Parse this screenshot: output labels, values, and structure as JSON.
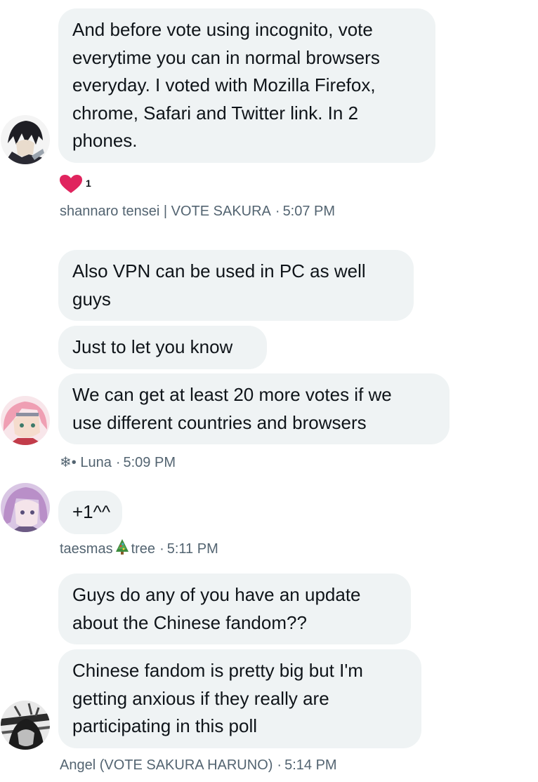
{
  "messages": [
    {
      "text": "And before vote using incognito, vote\neverytime you can in normal browsers\neveryday. I voted with Mozilla Firefox,\nchrome, Safari and Twitter link. In 2\nphones."
    },
    {
      "text": "Also VPN can be used in PC as well\nguys"
    },
    {
      "text": "Just to let you know"
    },
    {
      "text": "We can get at least 20 more votes if we\nuse different countries and browsers"
    },
    {
      "text": "+1^^"
    },
    {
      "text": "Guys do any of you have an update\nabout the Chinese fandom??"
    },
    {
      "text": "Chinese fandom is pretty big but I'm\ngetting anxious if they really are\nparticipating in this poll"
    }
  ],
  "reaction": {
    "icon": "heart-icon",
    "count": "1",
    "color": "#e0245e"
  },
  "senders": [
    {
      "name": "shannaro tensei | VOTE SAKURA",
      "time": "5:07 PM"
    },
    {
      "name_prefix": "❄•",
      "name": "Luna",
      "time": "5:09 PM"
    },
    {
      "name_a": "taesmas",
      "name_b": "tree",
      "time": "5:11 PM"
    },
    {
      "name": "Angel (VOTE SAKURA HARUNO)",
      "time": "5:14 PM"
    }
  ],
  "separator": "·",
  "colors": {
    "bubble": "#eff3f4",
    "text": "#0f1419",
    "meta": "#536471"
  }
}
